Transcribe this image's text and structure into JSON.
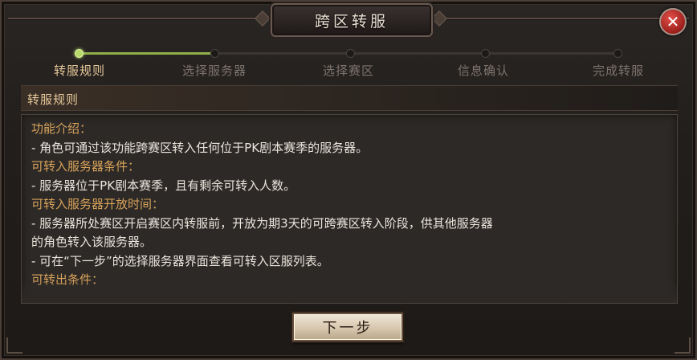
{
  "window": {
    "title": "跨区转服",
    "close_label": "✕"
  },
  "steps": {
    "progress": 0.25,
    "items": [
      {
        "label": "转服规则",
        "active": true
      },
      {
        "label": "选择服务器",
        "active": false
      },
      {
        "label": "选择赛区",
        "active": false
      },
      {
        "label": "信息确认",
        "active": false
      },
      {
        "label": "完成转服",
        "active": false
      }
    ]
  },
  "section": {
    "title": "转服规则"
  },
  "rules": [
    {
      "text": "功能介绍：",
      "type": "head"
    },
    {
      "text": "- 角色可通过该功能跨赛区转入任何位于PK剧本赛季的服务器。",
      "type": "body"
    },
    {
      "text": "可转入服务器条件：",
      "type": "head"
    },
    {
      "text": "- 服务器位于PK剧本赛季，且有剩余可转入人数。",
      "type": "body"
    },
    {
      "text": "可转入服务器开放时间：",
      "type": "head"
    },
    {
      "text": "- 服务器所处赛区开启赛区内转服前，开放为期3天的可跨赛区转入阶段，供其他服务器",
      "type": "body"
    },
    {
      "text": "的角色转入该服务器。",
      "type": "body"
    },
    {
      "text": "- 可在“下一步”的选择服务器界面查看可转入区服列表。",
      "type": "body"
    },
    {
      "text": "可转出条件：",
      "type": "head"
    }
  ],
  "footer": {
    "next_label": "下一步"
  },
  "colors": {
    "accent_gold": "#d9a35a",
    "progress_green": "#8fb04b",
    "close_red": "#c0302a"
  }
}
